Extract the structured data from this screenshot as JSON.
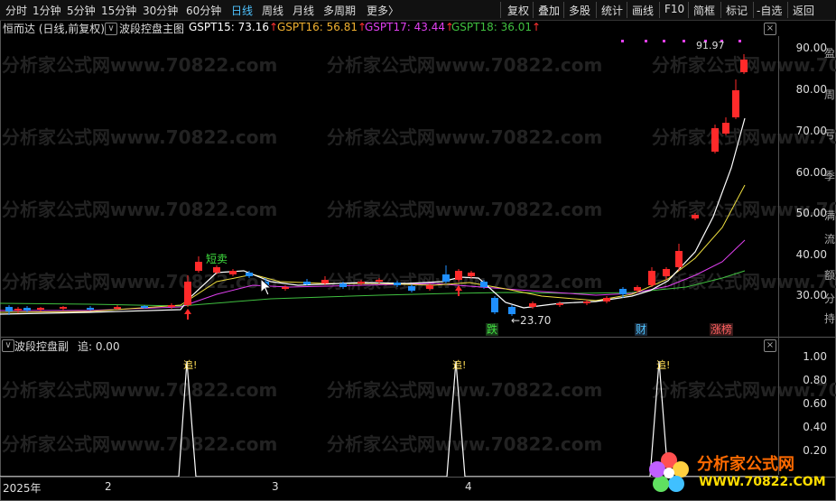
{
  "toolbar": {
    "items": [
      "分时",
      "1分钟",
      "5分钟",
      "15分钟",
      "30分钟",
      "60分钟",
      "日线",
      "周线",
      "月线",
      "多周期",
      "更多〉"
    ],
    "active": "日线",
    "right_items": [
      "复权",
      "叠加",
      "多股",
      "统计",
      "画线",
      "F10",
      "简框",
      "标记",
      "-自选",
      "返回"
    ]
  },
  "main": {
    "stock_title": "恒而达 (日线,前复权)",
    "indicator_name": "波段控盘主图",
    "gspt15": "GSPT15: 73.16",
    "gspt16": "GSPT16: 56.81",
    "gspt17": "GSPT17: 43.44",
    "gspt18": "GSPT18: 36.01",
    "arrow": "↑",
    "price_ticks": [
      "90.00",
      "80.00",
      "70.00",
      "60.00",
      "50.00",
      "40.00",
      "30.00"
    ],
    "high_label": "91.97",
    "low_label": "←23.70",
    "signals": {
      "short_sell": "短卖",
      "drop": "跌",
      "wealth": "财",
      "limit_up": "涨榜"
    }
  },
  "sub": {
    "indicator_name": "波段控盘副",
    "value": "追: 0.00",
    "ticks": [
      "1.00",
      "0.80",
      "0.60",
      "0.40",
      "0.20"
    ],
    "signal_label": "追!"
  },
  "dates": [
    "2025年",
    "2",
    "3",
    "4"
  ],
  "watermark": "分析家公式网www.70822.com",
  "logo": {
    "name": "分析家公式网",
    "url": "WWW.70822.COM"
  },
  "axis_chars": [
    "盈",
    "周",
    "亏",
    "季",
    "满",
    "流",
    "额",
    "分",
    "持"
  ],
  "colors": {
    "up": "#ff2a2a",
    "down": "#1f8fff",
    "ma_white": "#ffffff",
    "ma_yellow": "#f0e040",
    "ma_magenta": "#e040f0",
    "ma_green": "#40c040"
  }
}
